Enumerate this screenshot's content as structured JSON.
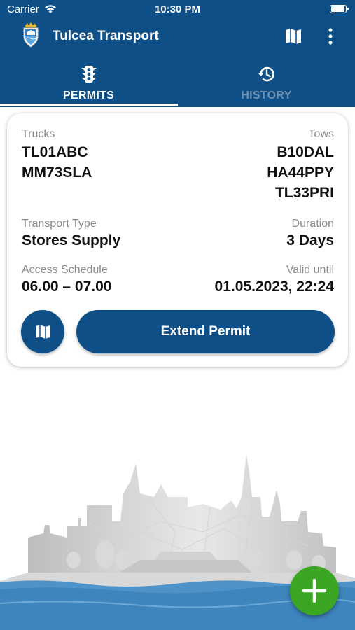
{
  "status_bar": {
    "carrier": "Carrier",
    "time": "10:30 PM",
    "battery_level": 1.0
  },
  "app_bar": {
    "title": "Tulcea Transport",
    "logo_icon": "coat-of-arms-icon",
    "map_icon": "map-icon",
    "more_icon": "more-vertical-icon"
  },
  "tabs": [
    {
      "label": "PERMITS",
      "icon": "traffic-light-icon",
      "selected": true
    },
    {
      "label": "HISTORY",
      "icon": "history-icon",
      "selected": false
    }
  ],
  "permit": {
    "trucks_label": "Trucks",
    "trucks": [
      "TL01ABC",
      "MM73SLA"
    ],
    "tows_label": "Tows",
    "tows": [
      "B10DAL",
      "HA44PPY",
      "TL33PRI"
    ],
    "transport_type_label": "Transport Type",
    "transport_type": "Stores Supply",
    "duration_label": "Duration",
    "duration": "3 Days",
    "schedule_label": "Access Schedule",
    "schedule": "06.00 – 07.00",
    "valid_until_label": "Valid until",
    "valid_until": "01.05.2023, 22:24",
    "extend_label": "Extend Permit"
  },
  "fab_icon": "plus-icon",
  "colors": {
    "primary": "#0d4f86",
    "fab": "#3aa623",
    "inactive_tab": "#6f8fae",
    "water": "#4d93c9"
  }
}
